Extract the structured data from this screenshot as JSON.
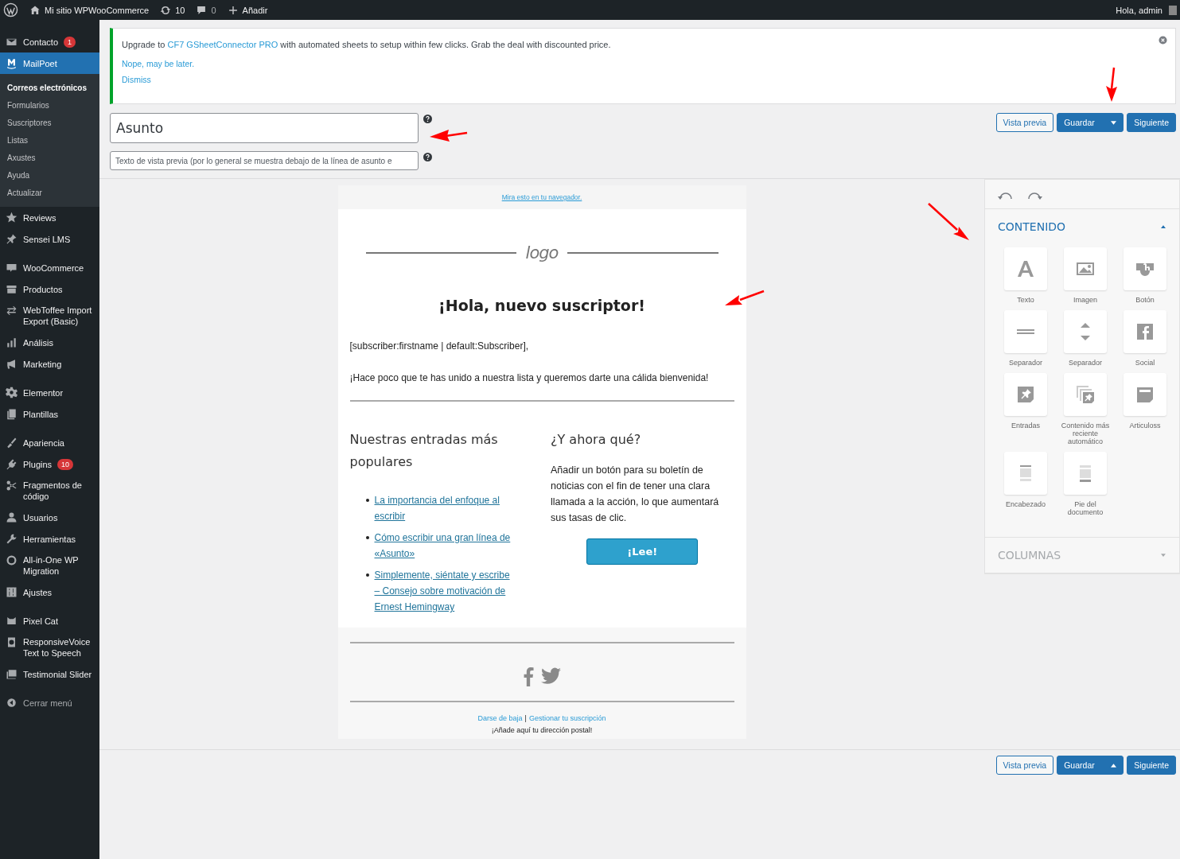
{
  "admin_bar": {
    "site": "Mi sitio WPWooCommerce",
    "updates": "10",
    "comments": "0",
    "new": "Añadir",
    "greeting": "Hola, admin"
  },
  "sidebar": {
    "groups": [
      [
        {
          "label": "Contacto",
          "selected": false,
          "badge": "1"
        },
        {
          "label": "MailPoet",
          "selected": true,
          "children": [
            {
              "label": "Correos electrónicos",
              "selected": true
            },
            {
              "label": "Formularios",
              "selected": false
            },
            {
              "label": "Suscriptores",
              "selected": false
            },
            {
              "label": "Listas",
              "selected": false
            },
            {
              "label": "Axustes",
              "selected": false
            },
            {
              "label": "Ayuda",
              "selected": false
            },
            {
              "label": "Actualizar",
              "selected": false
            }
          ]
        },
        {
          "label": "Reviews",
          "selected": false
        },
        {
          "label": "Sensei LMS",
          "selected": false
        }
      ],
      [
        {
          "label": "WooCommerce",
          "selected": false
        },
        {
          "label": "Productos",
          "selected": false
        },
        {
          "label": "WebToffee Import Export (Basic)",
          "selected": false
        },
        {
          "label": "Análisis",
          "selected": false
        },
        {
          "label": "Marketing",
          "selected": false
        }
      ],
      [
        {
          "label": "Elementor",
          "selected": false
        },
        {
          "label": "Plantillas",
          "selected": false
        }
      ],
      [
        {
          "label": "Apariencia",
          "selected": false
        },
        {
          "label": "Plugins",
          "selected": false,
          "badge": "10"
        },
        {
          "label": "Fragmentos de código",
          "selected": false
        },
        {
          "label": "Usuarios",
          "selected": false
        },
        {
          "label": "Herramientas",
          "selected": false
        },
        {
          "label": "All-in-One WP Migration",
          "selected": false
        },
        {
          "label": "Ajustes",
          "selected": false
        }
      ],
      [
        {
          "label": "Pixel Cat",
          "selected": false
        },
        {
          "label": "ResponsiveVoice Text to Speech",
          "selected": false
        },
        {
          "label": "Testimonial Slider",
          "selected": false
        }
      ]
    ],
    "collapse": "Cerrar menú"
  },
  "notice": {
    "before": "Upgrade to",
    "link": "CF7 GSheetConnector PRO",
    "after": "with automated sheets to setup within few clicks. Grab the deal with discounted price.",
    "links": [
      "Nope, may be later.",
      "Dismiss"
    ]
  },
  "subject": {
    "value": "Asunto"
  },
  "preheader": {
    "placeholder": "Texto de vista previa (por lo general se muestra debajo de la línea de asunto e"
  },
  "toolbars": [
    {
      "preview": "Vista previa",
      "save": "Guardar",
      "dropdown_up": false,
      "next": "Siguiente"
    },
    {
      "preview": "Vista previa",
      "save": "Guardar",
      "dropdown_up": true,
      "next": "Siguiente"
    }
  ],
  "email": {
    "browser_link": "Mira esto en tu navegador.",
    "logo": "logo",
    "heading": "¡Hola, nuevo suscriptor!",
    "greeting": "[subscriber:firstname | default:Subscriber],",
    "intro": "¡Hace poco que te has unido a nuestra lista y queremos darte una cálida bienvenida!",
    "left_title": "Nuestras entradas más populares",
    "posts": [
      "La importancia del enfoque al escribir",
      "Cómo escribir una gran línea de «Asunto»",
      "Simplemente, siéntate y escribe – Consejo sobre motivación de Ernest Hemingway"
    ],
    "right_title": "¿Y ahora qué?",
    "right_text": "Añadir un botón para su boletín de noticias con el fin de tener una clara llamada a la acción, lo que aumentará sus tasas de clic.",
    "cta": "¡Lee!",
    "footer_links": [
      "Darse de baja",
      "Gestionar tu suscripción"
    ],
    "footer_separator": "|",
    "address": "¡Añade aquí tu dirección postal!"
  },
  "panel": {
    "sections": [
      {
        "title": "CONTENIDO",
        "expanded": true,
        "blocks": [
          "Texto",
          "Imagen",
          "Botón",
          "Separador",
          "Separador",
          "Social",
          "Entradas",
          "Contenido más reciente automático",
          "Articuloss",
          "Encabezado",
          "Pie del documento"
        ]
      },
      {
        "title": "COLUMNAS",
        "expanded": false
      }
    ]
  }
}
